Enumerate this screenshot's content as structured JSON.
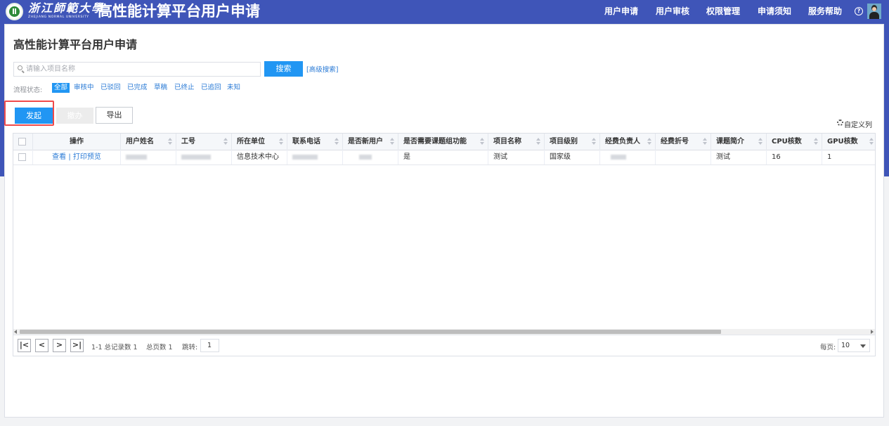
{
  "header": {
    "university_name": "浙江師範大學",
    "university_en": "ZHEJIANG NORMAL UNIVERSITY",
    "app_title": "高性能计算平台用户申请",
    "nav": [
      "用户申请",
      "用户审核",
      "权限管理",
      "申请须知",
      "服务帮助"
    ],
    "help_glyph": "?"
  },
  "page": {
    "title": "高性能计算平台用户申请"
  },
  "search": {
    "placeholder": "请输入项目名称",
    "value": "",
    "button": "搜索",
    "advanced": "[高级搜索]"
  },
  "filters": {
    "label": "流程状态:",
    "options": [
      "全部",
      "审核中",
      "已驳回",
      "已完成",
      "草稿",
      "已终止",
      "已追回",
      "未知"
    ],
    "active": "全部"
  },
  "toolbar": {
    "start": "发起",
    "revoke": "撤办",
    "export": "导出",
    "custom_columns": "自定义列"
  },
  "table": {
    "columns": [
      "操作",
      "用户姓名",
      "工号",
      "所在单位",
      "联系电话",
      "是否新用户",
      "是否需要课题组功能",
      "项目名称",
      "项目级别",
      "经费负责人",
      "经费折号",
      "课题简介",
      "CPU核数",
      "GPU核数"
    ],
    "rows": [
      {
        "actions": [
          "查看",
          "打印预览"
        ],
        "action_separator": "|",
        "department": "信息技术中心",
        "needs_group": "是",
        "project_name": "测试",
        "project_level": "国家级",
        "budget_no": "",
        "intro": "测试",
        "cpu": "16",
        "gpu": "1"
      }
    ]
  },
  "pager": {
    "first": "|<",
    "prev": "<",
    "next": ">",
    "last": ">|",
    "summary": "1-1 总记录数 1",
    "pages": "总页数 1",
    "jump_label": "跳转:",
    "jump_value": "1",
    "per_page_label": "每页:",
    "per_page_value": "10"
  },
  "colors": {
    "header_bg": "#3f55b8",
    "primary": "#2196f3",
    "link": "#2b7bd6",
    "highlight": "#f04a4a"
  }
}
